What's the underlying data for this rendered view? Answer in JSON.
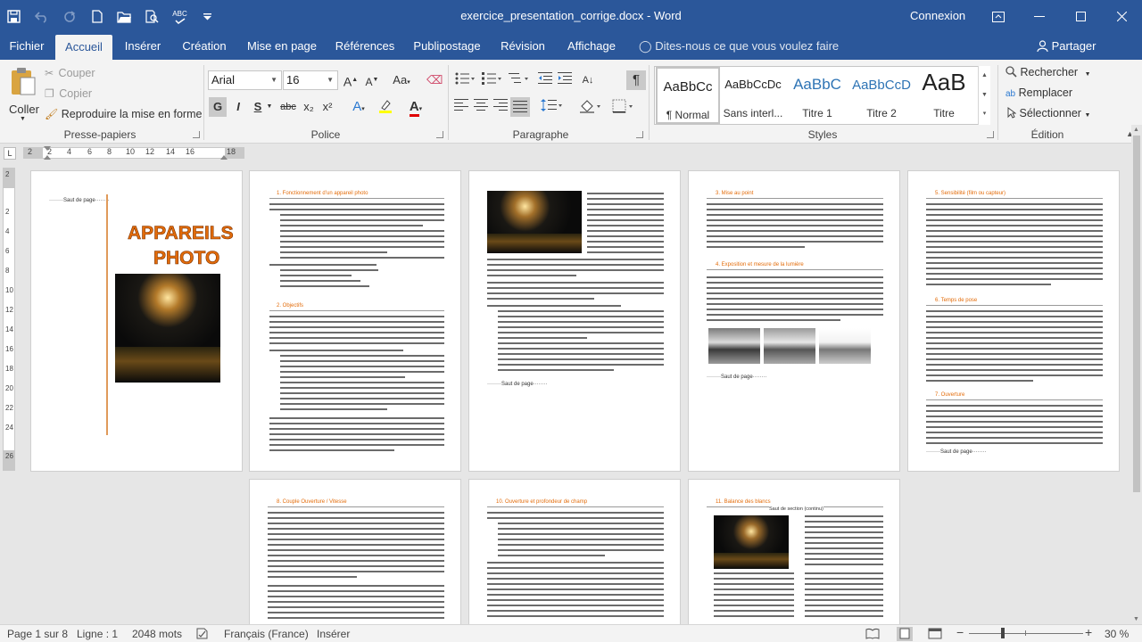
{
  "window": {
    "title": "exercice_presentation_corrige.docx - Word",
    "account": "Connexion"
  },
  "qat": {
    "save_icon": "save-icon",
    "undo_icon": "undo-icon",
    "redo_icon": "redo-icon",
    "new_icon": "new-document-icon",
    "open_icon": "open-folder-icon",
    "preview_icon": "print-preview-icon",
    "spelling_label": "ABC"
  },
  "tabs": [
    "Fichier",
    "Accueil",
    "Insérer",
    "Création",
    "Mise en page",
    "Références",
    "Publipostage",
    "Révision",
    "Affichage"
  ],
  "active_tab": "Accueil",
  "tell_me": "Dites-nous ce que vous voulez faire",
  "share": "Partager",
  "ribbon": {
    "clipboard": {
      "paste": "Coller",
      "cut": "Couper",
      "copy": "Copier",
      "format_painter": "Reproduire la mise en forme",
      "group": "Presse-papiers"
    },
    "font": {
      "name": "Arial",
      "size": "16",
      "bold": "G",
      "italic": "I",
      "underline": "S",
      "strike": "abc",
      "subscript": "x₂",
      "superscript": "x²",
      "grow": "A",
      "shrink": "A",
      "case": "Aa",
      "group": "Police"
    },
    "paragraph": {
      "pilcrow": "¶",
      "group": "Paragraphe"
    },
    "styles": {
      "items": [
        {
          "preview": "AaBbCc",
          "name": "¶ Normal"
        },
        {
          "preview": "AaBbCcDc",
          "name": "Sans interl..."
        },
        {
          "preview": "AaBbC",
          "name": "Titre 1"
        },
        {
          "preview": "AaBbCcD",
          "name": "Titre 2"
        },
        {
          "preview": "AaB",
          "name": "Titre"
        }
      ],
      "group": "Styles"
    },
    "editing": {
      "find": "Rechercher",
      "replace": "Remplacer",
      "select": "Sélectionner",
      "group": "Édition"
    }
  },
  "ruler": {
    "h_ticks": [
      "2",
      "2",
      "4",
      "6",
      "8",
      "10",
      "12",
      "14",
      "16",
      "18"
    ],
    "v_ticks": [
      "2",
      "2",
      "4",
      "6",
      "8",
      "10",
      "12",
      "14",
      "16",
      "18",
      "20",
      "22",
      "24",
      "26"
    ]
  },
  "pages": {
    "p1": {
      "break_text": "········Saut de page········",
      "title_line1": "APPAREILS",
      "title_line2": "PHOTO"
    },
    "p2": {
      "h1": "1.  Fonctionnement d’un appareil photo",
      "h2": "2.  Objectifs"
    },
    "p3": {
      "break_text": "········Saut de page········"
    },
    "p4": {
      "h1": "3.  Mise au point",
      "h2": "4.  Exposition et mesure de la lumière",
      "break_text": "········Saut de page········"
    },
    "p5": {
      "h1": "5.  Sensibilité (film ou capteur)",
      "h2": "6.  Temps de pose",
      "h3": "7.  Ouverture",
      "break_text": "········Saut de page········"
    },
    "p6": {
      "h1": "8.  Couple Ouverture / Vitesse"
    },
    "p7": {
      "h1": "10.  Ouverture et profondeur de champ"
    },
    "p8": {
      "h1": "11.  Balance des blancs",
      "section_break": "Saut de section (continu)"
    }
  },
  "status": {
    "page": "Page 1 sur 8",
    "line": "Ligne : 1",
    "words": "2048 mots",
    "language": "Français (France)",
    "mode": "Insérer",
    "zoom": "30 %",
    "zoom_minus": "−",
    "zoom_plus": "+"
  },
  "colors": {
    "brand": "#2b579a",
    "heading": "#e36c0a"
  }
}
